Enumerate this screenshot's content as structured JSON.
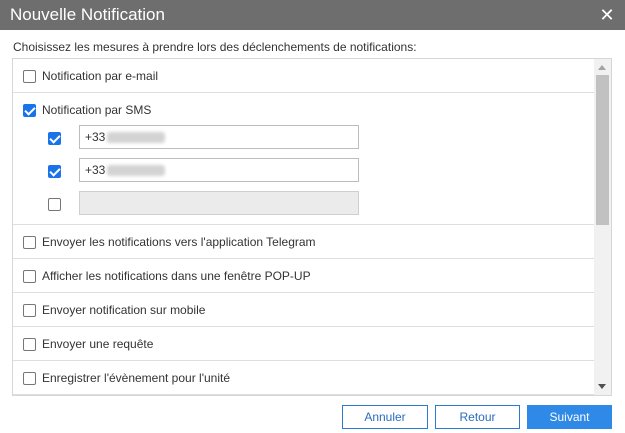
{
  "dialog": {
    "title": "Nouvelle Notification",
    "close_glyph": "✕"
  },
  "intro": "Choisissez les mesures à prendre lors des déclenchements de notifications:",
  "options": {
    "email": {
      "label": "Notification par e-mail",
      "checked": false
    },
    "sms": {
      "label": "Notification par SMS",
      "checked": true,
      "phones": [
        {
          "checked": true,
          "value": "+33",
          "redacted": true,
          "disabled": false
        },
        {
          "checked": true,
          "value": "+33",
          "redacted": true,
          "disabled": false
        },
        {
          "checked": false,
          "value": "",
          "redacted": false,
          "disabled": true
        }
      ]
    },
    "telegram": {
      "label": "Envoyer les notifications vers l'application Telegram",
      "checked": false
    },
    "popup": {
      "label": "Afficher les notifications dans une fenêtre POP-UP",
      "checked": false
    },
    "mobile": {
      "label": "Envoyer notification sur mobile",
      "checked": false
    },
    "request": {
      "label": "Envoyer une requête",
      "checked": false
    },
    "event": {
      "label": "Enregistrer l'évènement pour l'unité",
      "checked": false
    }
  },
  "buttons": {
    "cancel": "Annuler",
    "back": "Retour",
    "next": "Suivant"
  },
  "colors": {
    "titlebar": "#6e6e6e",
    "accent": "#2e8ae6",
    "checkbox_checked": "#1a73e8"
  }
}
